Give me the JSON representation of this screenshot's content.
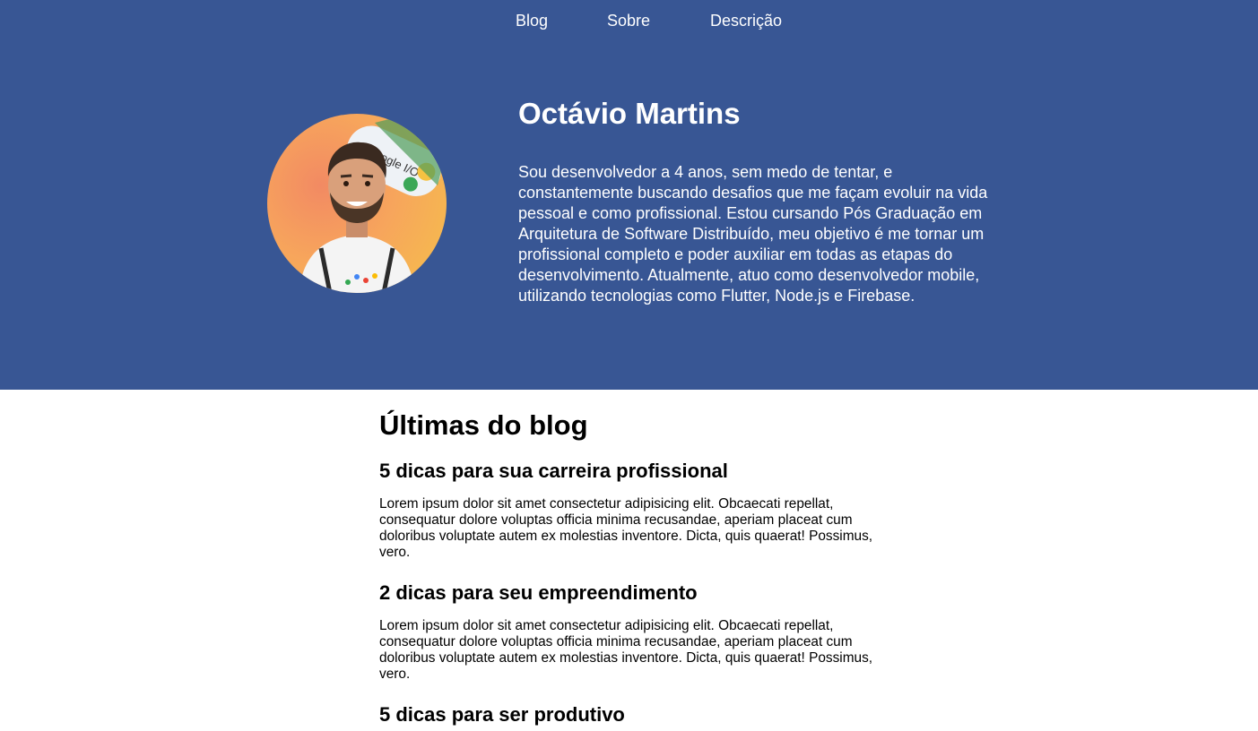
{
  "nav": {
    "items": [
      {
        "label": "Blog"
      },
      {
        "label": "Sobre"
      },
      {
        "label": "Descrição"
      }
    ]
  },
  "hero": {
    "name": "Octávio Martins",
    "description": "Sou desenvolvedor a 4 anos, sem medo de tentar, e constantemente buscando desafios que me façam evoluir na vida pessoal e como profissional. Estou cursando Pós Graduação em Arquitetura de Software Distribuído, meu objetivo é me tornar um profissional completo e poder auxiliar em todas as etapas do desenvolvimento. Atualmente, atuo como desenvolvedor mobile, utilizando tecnologias como Flutter, Node.js e Firebase.",
    "avatar_icon": "profile-photo",
    "background_color": "#385694"
  },
  "blog": {
    "title": "Últimas do blog",
    "posts": [
      {
        "title": "5 dicas para sua carreira profissional",
        "body": "Lorem ipsum dolor sit amet consectetur adipisicing elit. Obcaecati repellat, consequatur dolore voluptas officia minima recusandae, aperiam placeat cum doloribus voluptate autem ex molestias inventore. Dicta, quis quaerat! Possimus, vero."
      },
      {
        "title": "2 dicas para seu empreendimento",
        "body": "Lorem ipsum dolor sit amet consectetur adipisicing elit. Obcaecati repellat, consequatur dolore voluptas officia minima recusandae, aperiam placeat cum doloribus voluptate autem ex molestias inventore. Dicta, quis quaerat! Possimus, vero."
      },
      {
        "title": "5 dicas para ser produtivo",
        "body": ""
      }
    ]
  }
}
